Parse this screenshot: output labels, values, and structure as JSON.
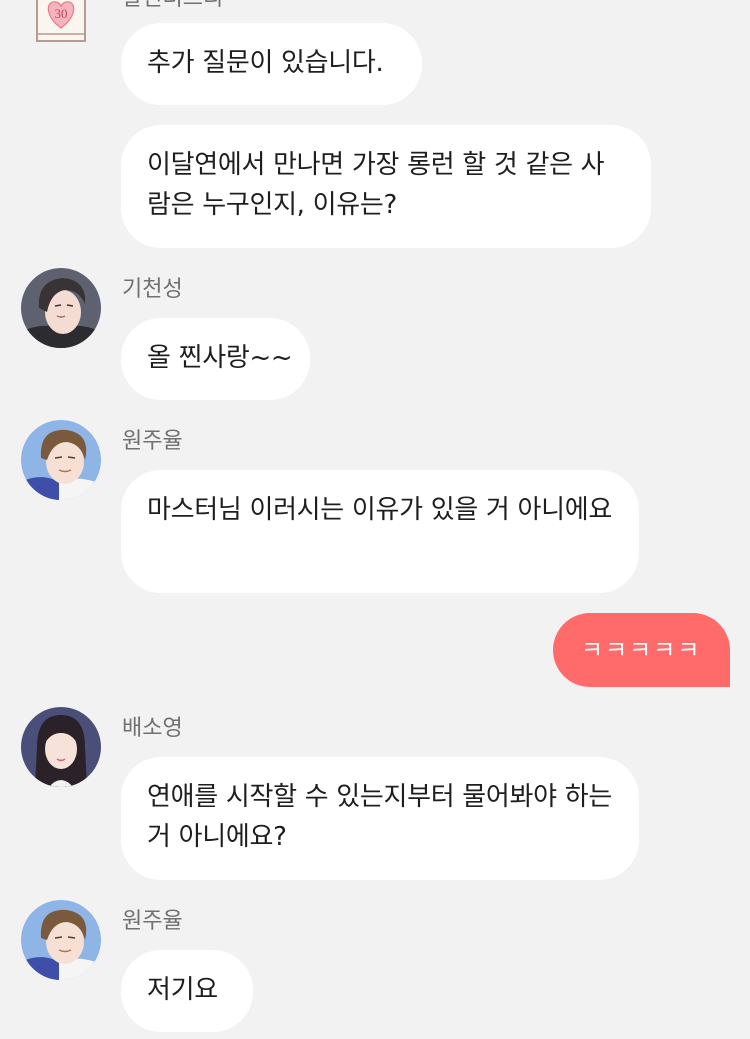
{
  "conversation": {
    "top_sender_partial": "칼린더프리",
    "calendar_badge": "30",
    "messages": [
      {
        "text": "추가 질문이 있습니다."
      },
      {
        "text": "이달연에서 만나면 가장 롱런 할 것 같은 사람은 누구인지, 이유는?"
      },
      {
        "sender": "기천성",
        "text": "올 찐사랑~~"
      },
      {
        "sender": "원주율",
        "text": "마스터님 이러시는 이유가 있을 거 아니에요"
      },
      {
        "mine": true,
        "text": "ㅋㅋㅋㅋㅋ"
      },
      {
        "sender": "배소영",
        "text": "연애를 시작할 수 있는지부터 물어봐야 하는거 아니에요?"
      },
      {
        "sender": "원주율",
        "text": "저기요"
      }
    ]
  },
  "colors": {
    "background": "#f2f2f2",
    "bubble_other": "#ffffff",
    "bubble_mine": "#ff6b6b",
    "sender_name": "#707070"
  }
}
